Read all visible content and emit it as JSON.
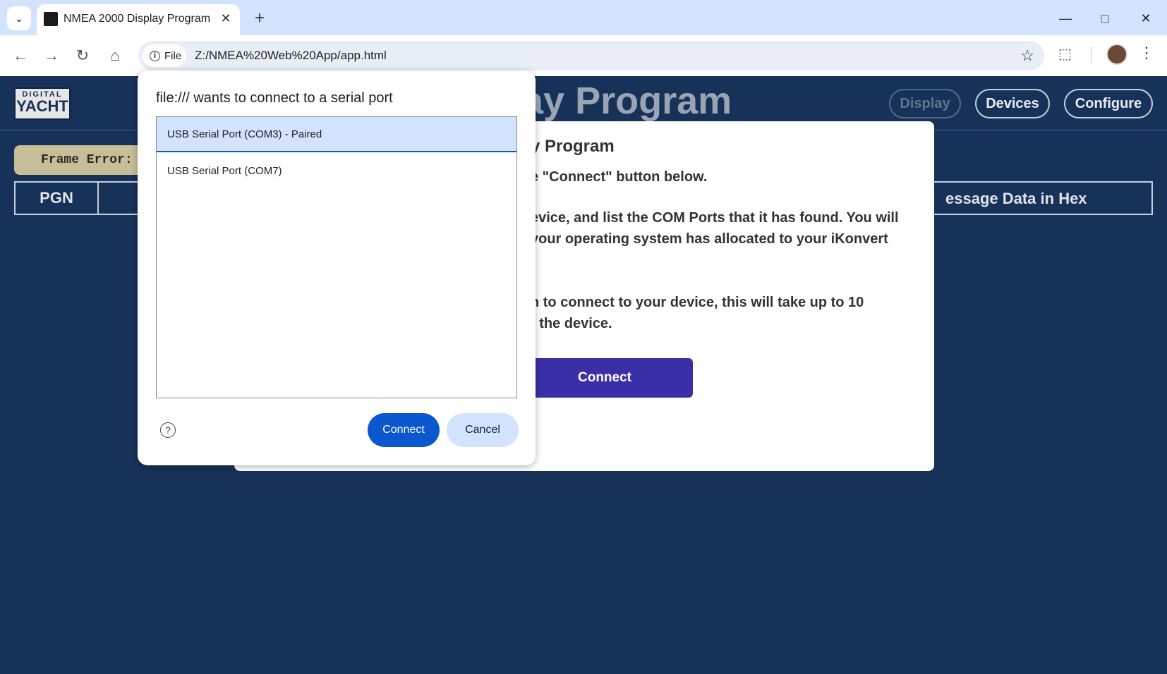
{
  "browser": {
    "tab_title": "NMEA 2000 Display Program",
    "site_chip_label": "File",
    "url": "Z:/NMEA%20Web%20App/app.html",
    "icons": [
      "tab-search-icon",
      "favicon-icon",
      "close-icon",
      "plus-icon",
      "minimize-icon",
      "maximize-icon",
      "window-close-icon",
      "back-icon",
      "forward-icon",
      "reload-icon",
      "home-icon",
      "info-icon",
      "star-icon",
      "extensions-icon",
      "avatar",
      "kebab-menu-icon"
    ]
  },
  "app": {
    "logo_line1": "DIGITAL",
    "logo_line2": "YACHT",
    "title_partial": "ay Program",
    "nav": [
      "Display",
      "Devices",
      "Configure"
    ],
    "frame_error_label": "Frame Error:",
    "table": {
      "col_pgn": "PGN",
      "col_hex_partial": "essage Data in Hex"
    }
  },
  "modal": {
    "title_partial": "y Program",
    "lines": [
      "e \"Connect\" button below.",
      "evice, and list the COM Ports that it has found. You will",
      "your operating system has allocated to your iKonvert",
      "n to connect to your device, this will take up to 10",
      "f the device."
    ],
    "connect_label": "Connect"
  },
  "chooser": {
    "title": "file:/// wants to connect to a serial port",
    "ports": [
      {
        "label": "USB Serial Port (COM3) - Paired",
        "selected": true
      },
      {
        "label": "USB Serial Port (COM7)",
        "selected": false
      }
    ],
    "connect_label": "Connect",
    "cancel_label": "Cancel"
  }
}
